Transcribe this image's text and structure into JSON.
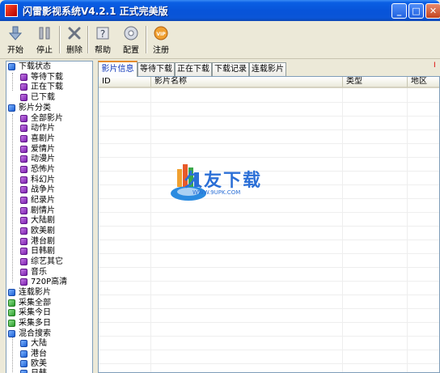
{
  "window": {
    "title": "闪雷影视系统V4.2.1 正式完美版",
    "controls": {
      "minimize": "_",
      "maximize": "□",
      "close": "✕"
    }
  },
  "toolbar": {
    "items": [
      {
        "label": "开始",
        "icon": "download-arrow-icon"
      },
      {
        "label": "停止",
        "icon": "pause-icon"
      },
      {
        "label": "删除",
        "icon": "delete-x-icon"
      },
      {
        "label": "帮助",
        "icon": "help-icon"
      },
      {
        "label": "配置",
        "icon": "settings-disc-icon"
      },
      {
        "label": "注册",
        "icon": "register-badge-icon"
      }
    ],
    "badge_text": "VIP",
    "right_mark": "I"
  },
  "tree": {
    "download_status": {
      "label": "下载状态",
      "children": [
        "等待下载",
        "正在下载",
        "已下载"
      ]
    },
    "movie_category": {
      "label": "影片分类",
      "children": [
        "全部影片",
        "动作片",
        "喜剧片",
        "爱情片",
        "动漫片",
        "恐怖片",
        "科幻片",
        "战争片",
        "纪录片",
        "剧情片",
        "大陆剧",
        "欧美剧",
        "港台剧",
        "日韩剧",
        "综艺其它",
        "音乐",
        "720P高清"
      ]
    },
    "series": "连载影片",
    "collect_all": "采集全部",
    "collect_today": "采集今日",
    "collect_multi": "采集多日",
    "mixed_search": {
      "label": "混合搜索",
      "children": [
        "大陆",
        "港台",
        "欧美",
        "日韩"
      ]
    }
  },
  "tabs": [
    "影片信息",
    "等待下载",
    "正在下载",
    "下载记录",
    "连载影片"
  ],
  "active_tab": "影片信息",
  "list": {
    "columns": [
      "ID",
      "影片名称",
      "类型",
      "地区"
    ]
  },
  "watermark": {
    "text": "久友下载",
    "url": "WWW.9UPK.COM"
  },
  "colors": {
    "title_bar": "#0754d9",
    "tab_highlight": "#e68b2c",
    "tree_icon_blue": "#1a5fd4",
    "tree_icon_purple": "#7a1fae",
    "tree_icon_green": "#2a9a2a"
  }
}
